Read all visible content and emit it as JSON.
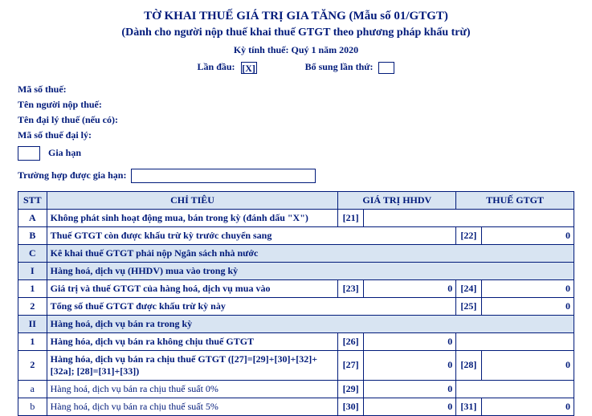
{
  "header": {
    "title": "TỜ KHAI THUẾ GIÁ TRỊ GIA TĂNG (Mẫu số 01/GTGT)",
    "subtitle": "(Dành cho người nộp thuế khai thuế GTGT theo phương pháp khấu trừ)",
    "period": "Kỳ tính thuế: Quý 1 năm 2020",
    "first_time_label": "Lần đầu:",
    "first_time_value": "[X]",
    "supplement_label": "Bổ sung lần thứ:",
    "supplement_value": ""
  },
  "info": {
    "tax_code_label": "Mã số thuế:",
    "taxpayer_label": "Tên người nộp thuế:",
    "agent_label": "Tên đại lý thuế (nếu có):",
    "agent_tax_code_label": "Mã số thuế đại lý:",
    "extension_label": "Gia hạn",
    "extension_case_label": "Trường hợp được gia hạn:",
    "extension_case_value": ""
  },
  "table": {
    "headers": {
      "stt": "STT",
      "chi_tieu": "CHỈ TIÊU",
      "gia_tri": "GIÁ TRỊ HHDV",
      "thue": "THUẾ GTGT"
    },
    "rows": [
      {
        "stt": "A",
        "label": "Không phát sinh hoạt động mua, bán trong kỳ (đánh dấu \"X\")",
        "c1": "[21]",
        "v1": "",
        "c2": "",
        "v2": "",
        "span": 3
      },
      {
        "stt": "B",
        "label": "Thuế GTGT còn được khấu trừ kỳ trước chuyển sang",
        "c1": "",
        "v1": "",
        "c2": "[22]",
        "v2": "0",
        "span": 3,
        "mid": true
      },
      {
        "stt": "C",
        "label": "Kê khai thuế GTGT phải nộp Ngân sách nhà nước",
        "section": true
      },
      {
        "stt": "I",
        "label": "Hàng hoá, dịch vụ (HHDV) mua vào trong kỳ",
        "section": true
      },
      {
        "stt": "1",
        "label": "Giá trị và thuế GTGT của hàng hoá, dịch vụ mua vào",
        "c1": "[23]",
        "v1": "0",
        "c2": "[24]",
        "v2": "0"
      },
      {
        "stt": "2",
        "label": "Tổng số thuế GTGT  được khấu trừ kỳ này",
        "c1": "",
        "v1": "",
        "c2": "[25]",
        "v2": "0",
        "mid": true,
        "span": 3
      },
      {
        "stt": "II",
        "label": "Hàng hoá, dịch vụ bán ra trong kỳ",
        "section": true
      },
      {
        "stt": "1",
        "label": "Hàng hóa, dịch vụ bán ra không chịu thuế GTGT",
        "c1": "[26]",
        "v1": "0",
        "c2": "",
        "v2": "",
        "span_end": 2
      },
      {
        "stt": "2",
        "label": "Hàng hóa, dịch vụ bán ra chịu thuế GTGT ([27]=[29]+[30]+[32]+[32a]; [28]=[31]+[33])",
        "c1": "[27]",
        "v1": "0",
        "c2": "[28]",
        "v2": "0"
      },
      {
        "stt": "a",
        "label": "Hàng hoá, dịch vụ bán ra chịu thuế suất 0%",
        "c1": "[29]",
        "v1": "0",
        "c2": "",
        "v2": "",
        "light": true,
        "span_end": 2
      },
      {
        "stt": "b",
        "label": "Hàng hoá, dịch vụ bán ra chịu thuế suất 5%",
        "c1": "[30]",
        "v1": "0",
        "c2": "[31]",
        "v2": "0",
        "light": true
      }
    ]
  }
}
